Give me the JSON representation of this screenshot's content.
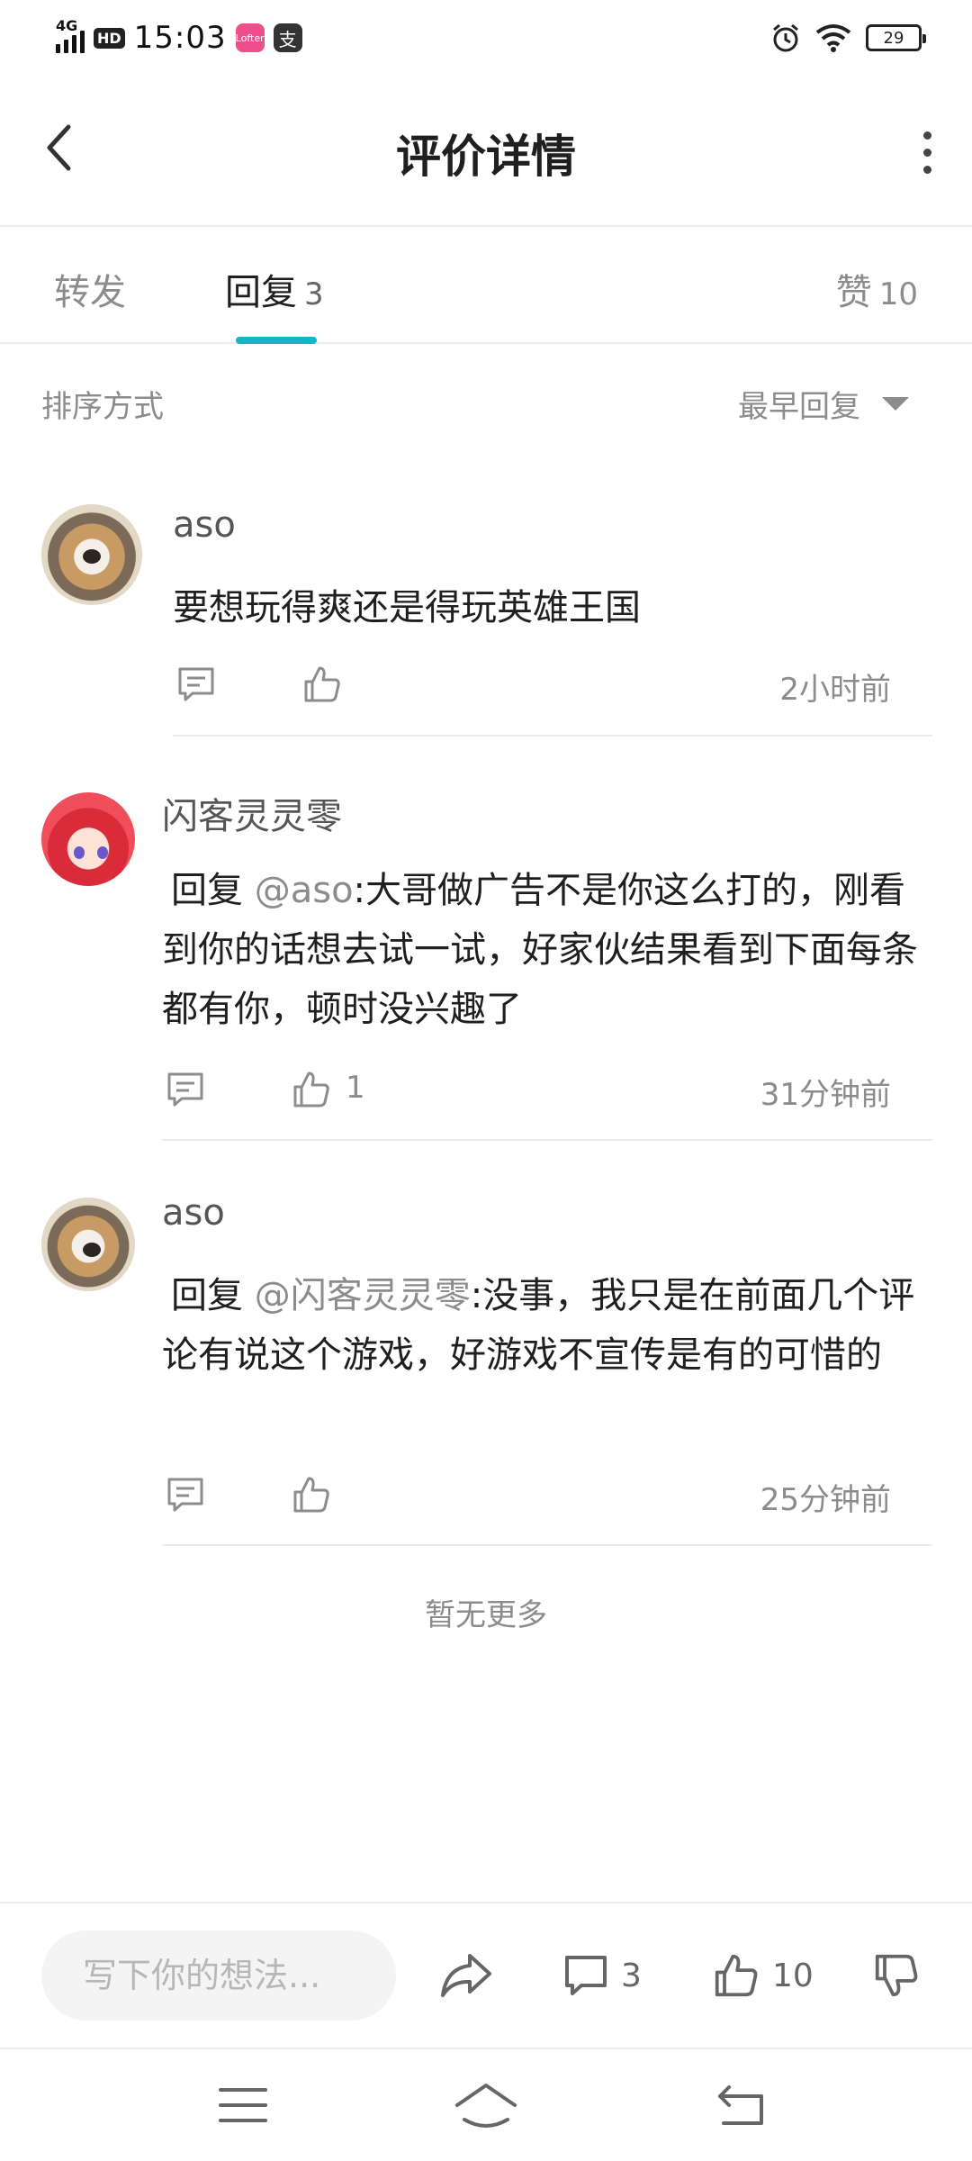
{
  "status_bar": {
    "network": "4G",
    "hd": "HD",
    "time": "15:03",
    "app1": "Lofter",
    "app2": "支",
    "battery": "29"
  },
  "header": {
    "title": "评价详情"
  },
  "tabs": {
    "forward": "转发",
    "reply": "回复",
    "reply_count": "3",
    "like": "赞",
    "like_count": "10"
  },
  "sort": {
    "label": "排序方式",
    "value": "最早回复"
  },
  "comments": [
    {
      "author": "aso",
      "body": "要想玩得爽还是得玩英雄王国",
      "like_count": "",
      "time": "2小时前"
    },
    {
      "author": "闪客灵灵零",
      "reply_prefix": "回复",
      "mention": "@aso",
      "body": ":大哥做广告不是你这么打的，刚看到你的话想去试一试，好家伙结果看到下面每条都有你，顿时没兴趣了",
      "like_count": "1",
      "time": "31分钟前"
    },
    {
      "author": "aso",
      "reply_prefix": "回复",
      "mention": "@闪客灵灵零",
      "body": ":没事，我只是在前面几个评论有说这个游戏，好游戏不宣传是有的可惜的",
      "like_count": "",
      "time": "25分钟前"
    }
  ],
  "no_more": "暂无更多",
  "input_bar": {
    "placeholder": "写下你的想法...",
    "comment_count": "3",
    "like_count": "10"
  }
}
